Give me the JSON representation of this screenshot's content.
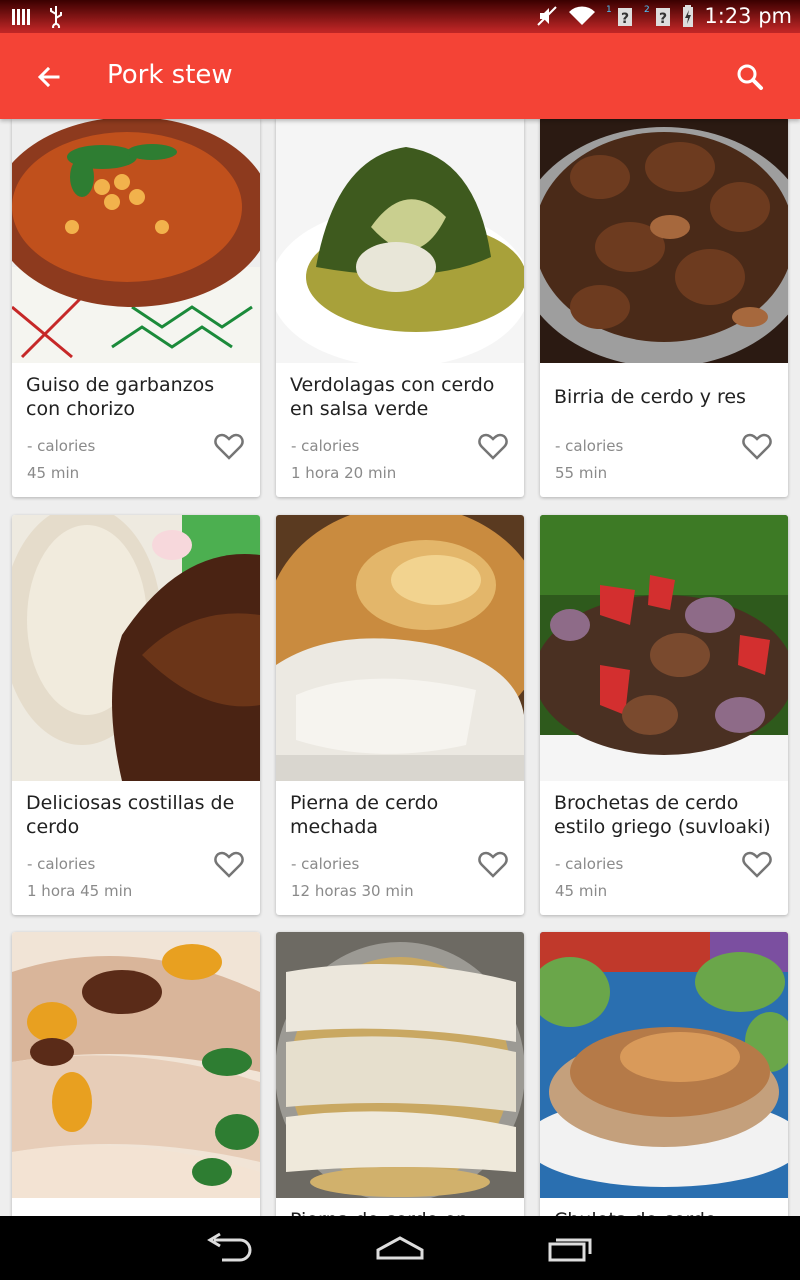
{
  "status_bar": {
    "time": "1:23 pm",
    "icons": [
      "notification-bars-icon",
      "usb-icon",
      "mute-icon",
      "wifi-icon",
      "sim1-unknown-icon",
      "sim2-unknown-icon",
      "battery-charging-icon"
    ]
  },
  "app_bar": {
    "title": "Pork stew",
    "back_icon": "arrow-back-icon",
    "search_icon": "search-icon",
    "color": "#f44336"
  },
  "recipes": [
    {
      "title": "Guiso de garbanzos con chorizo",
      "calories": "- calories",
      "time": "45 min"
    },
    {
      "title": "Verdolagas con cerdo en salsa verde",
      "calories": "- calories",
      "time": "1 hora 20 min"
    },
    {
      "title": "Birria de cerdo y res",
      "calories": "- calories",
      "time": "55 min"
    },
    {
      "title": "Deliciosas costillas de cerdo",
      "calories": "- calories",
      "time": "1 hora 45 min"
    },
    {
      "title": "Pierna de cerdo mechada",
      "calories": "- calories",
      "time": "12 horas 30 min"
    },
    {
      "title": "Brochetas de cerdo estilo griego (suvloaki)",
      "calories": "- calories",
      "time": "45 min"
    },
    {
      "title": "",
      "calories": "",
      "time": ""
    },
    {
      "title": "Pierna de cerdo en salsa",
      "calories": "",
      "time": ""
    },
    {
      "title": "Chuleta de cerdo",
      "calories": "",
      "time": ""
    }
  ],
  "nav_bar": {
    "icons": [
      "back-nav-icon",
      "home-nav-icon",
      "recents-nav-icon"
    ]
  }
}
